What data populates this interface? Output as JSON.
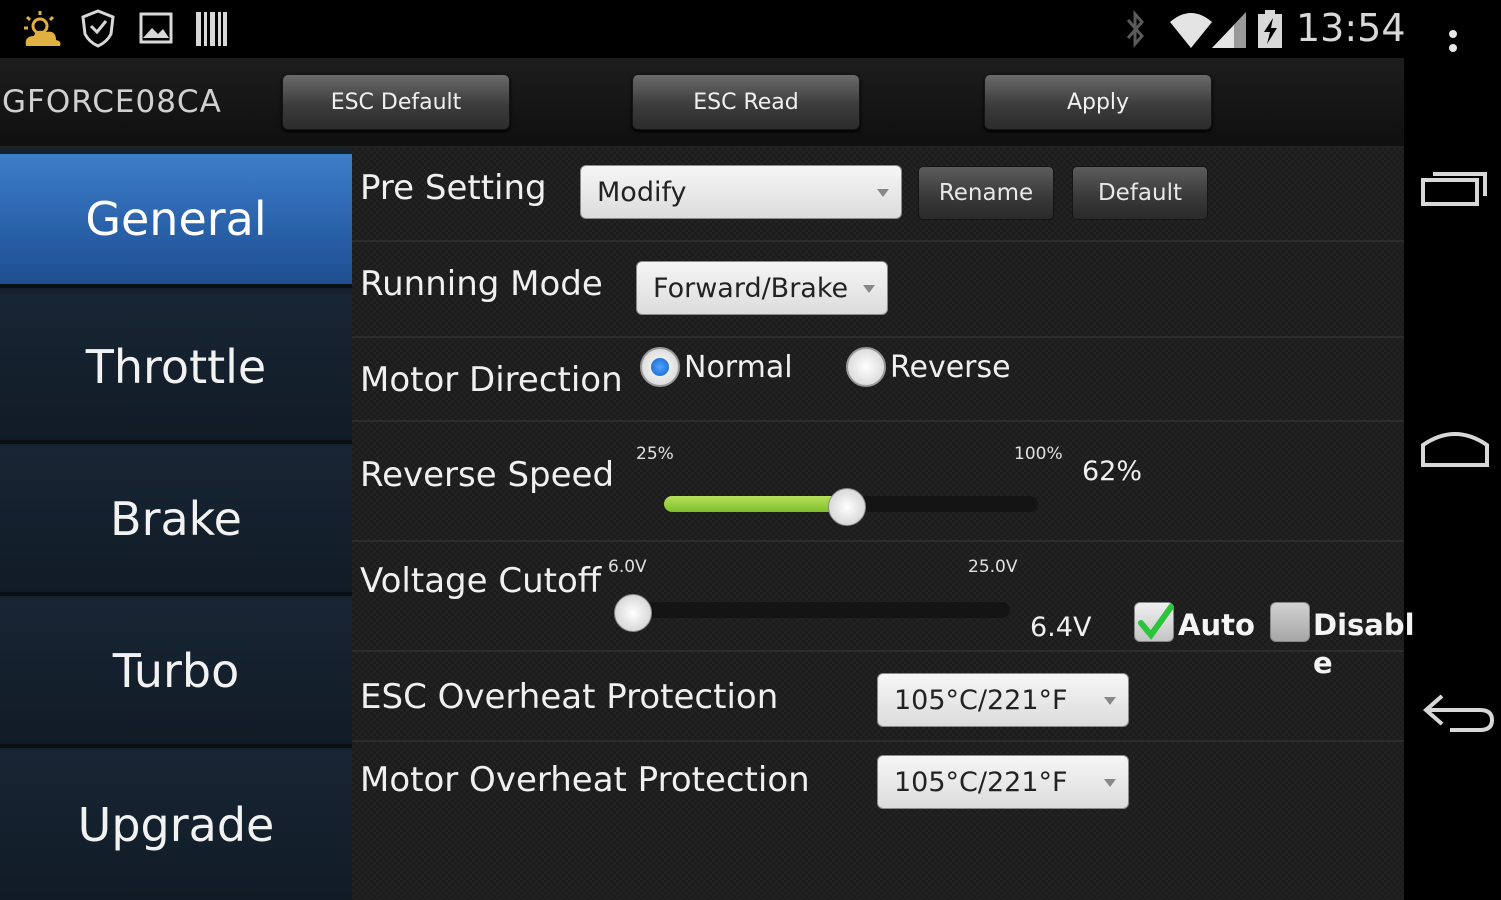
{
  "status_bar": {
    "time": "13:54",
    "left_icons": [
      "weather-icon",
      "shield-icon",
      "image-icon",
      "barcode-icon"
    ],
    "right_icons": [
      "bluetooth-icon",
      "wifi-icon",
      "signal-icon",
      "battery-icon"
    ]
  },
  "header": {
    "device_name": "GFORCE08CA",
    "buttons": {
      "esc_default": "ESC Default",
      "esc_read": "ESC Read",
      "apply": "Apply"
    }
  },
  "sidebar": {
    "items": [
      {
        "label": "General",
        "active": true
      },
      {
        "label": "Throttle"
      },
      {
        "label": "Brake"
      },
      {
        "label": "Turbo"
      },
      {
        "label": "Upgrade"
      }
    ]
  },
  "settings": {
    "pre_setting": {
      "label": "Pre Setting",
      "value": "Modify",
      "rename": "Rename",
      "default": "Default"
    },
    "running_mode": {
      "label": "Running Mode",
      "value": "Forward/Brake"
    },
    "motor_direction": {
      "label": "Motor Direction",
      "options": [
        "Normal",
        "Reverse"
      ],
      "selected": "Normal"
    },
    "reverse_speed": {
      "label": "Reverse Speed",
      "min_label": "25%",
      "max_label": "100%",
      "value": "62%",
      "level": 0.49
    },
    "voltage_cutoff": {
      "label": "Voltage Cutoff",
      "min_label": "6.0V",
      "max_label": "25.0V",
      "value": "6.4V",
      "level": 0.02,
      "auto": {
        "label": "Auto",
        "checked": true
      },
      "disable": {
        "label_line1": "Disabl",
        "label_line2": "e",
        "checked": false
      }
    },
    "esc_overheat": {
      "label": "ESC Overheat Protection",
      "value": "105°C/221°F"
    },
    "motor_overheat": {
      "label": "Motor Overheat Protection",
      "value": "105°C/221°F"
    }
  },
  "colors": {
    "accent": "#2d6bb5",
    "slider_fill": "#9ad040",
    "check": "#2cc43a"
  }
}
